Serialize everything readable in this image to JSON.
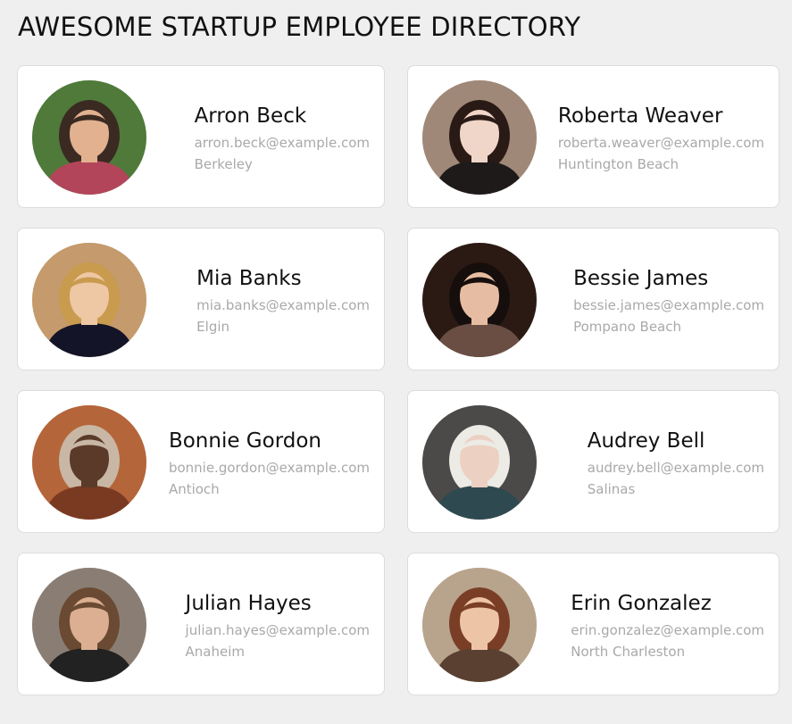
{
  "header": {
    "title": "AWESOME STARTUP EMPLOYEE DIRECTORY"
  },
  "employees": [
    {
      "name": "Arron Beck",
      "email": "arron.beck@example.com",
      "city": "Berkeley",
      "avatar": {
        "bg": "#4f7a3a",
        "skin": "#e2b190",
        "hair": "#3a2a22",
        "shirt": "#b2455a"
      }
    },
    {
      "name": "Roberta Weaver",
      "email": "roberta.weaver@example.com",
      "city": "Huntington Beach",
      "avatar": {
        "bg": "#a08878",
        "skin": "#f0d6c8",
        "hair": "#2a1a16",
        "shirt": "#1e1a1a"
      }
    },
    {
      "name": "Mia Banks",
      "email": "mia.banks@example.com",
      "city": "Elgin",
      "avatar": {
        "bg": "#c59a6c",
        "skin": "#eec7a4",
        "hair": "#c99b4e",
        "shirt": "#141428"
      }
    },
    {
      "name": "Bessie James",
      "email": "bessie.james@example.com",
      "city": "Pompano Beach",
      "avatar": {
        "bg": "#2b1a14",
        "skin": "#e6bda2",
        "hair": "#160e0c",
        "shirt": "#6a4e44"
      }
    },
    {
      "name": "Bonnie Gordon",
      "email": "bonnie.gordon@example.com",
      "city": "Antioch",
      "avatar": {
        "bg": "#b5653a",
        "skin": "#5b3a2a",
        "hair": "#c8b7a4",
        "shirt": "#7a3a22"
      }
    },
    {
      "name": "Audrey Bell",
      "email": "audrey.bell@example.com",
      "city": "Salinas",
      "avatar": {
        "bg": "#4c4a48",
        "skin": "#ecd0c2",
        "hair": "#ecebe6",
        "shirt": "#2e4a50"
      }
    },
    {
      "name": "Julian Hayes",
      "email": "julian.hayes@example.com",
      "city": "Anaheim",
      "avatar": {
        "bg": "#8a7e74",
        "skin": "#dcae92",
        "hair": "#6a4a32",
        "shirt": "#222222"
      }
    },
    {
      "name": "Erin Gonzalez",
      "email": "erin.gonzalez@example.com",
      "city": "North Charleston",
      "avatar": {
        "bg": "#b8a48c",
        "skin": "#eec4a6",
        "hair": "#7a3e26",
        "shirt": "#5a4030"
      }
    }
  ]
}
